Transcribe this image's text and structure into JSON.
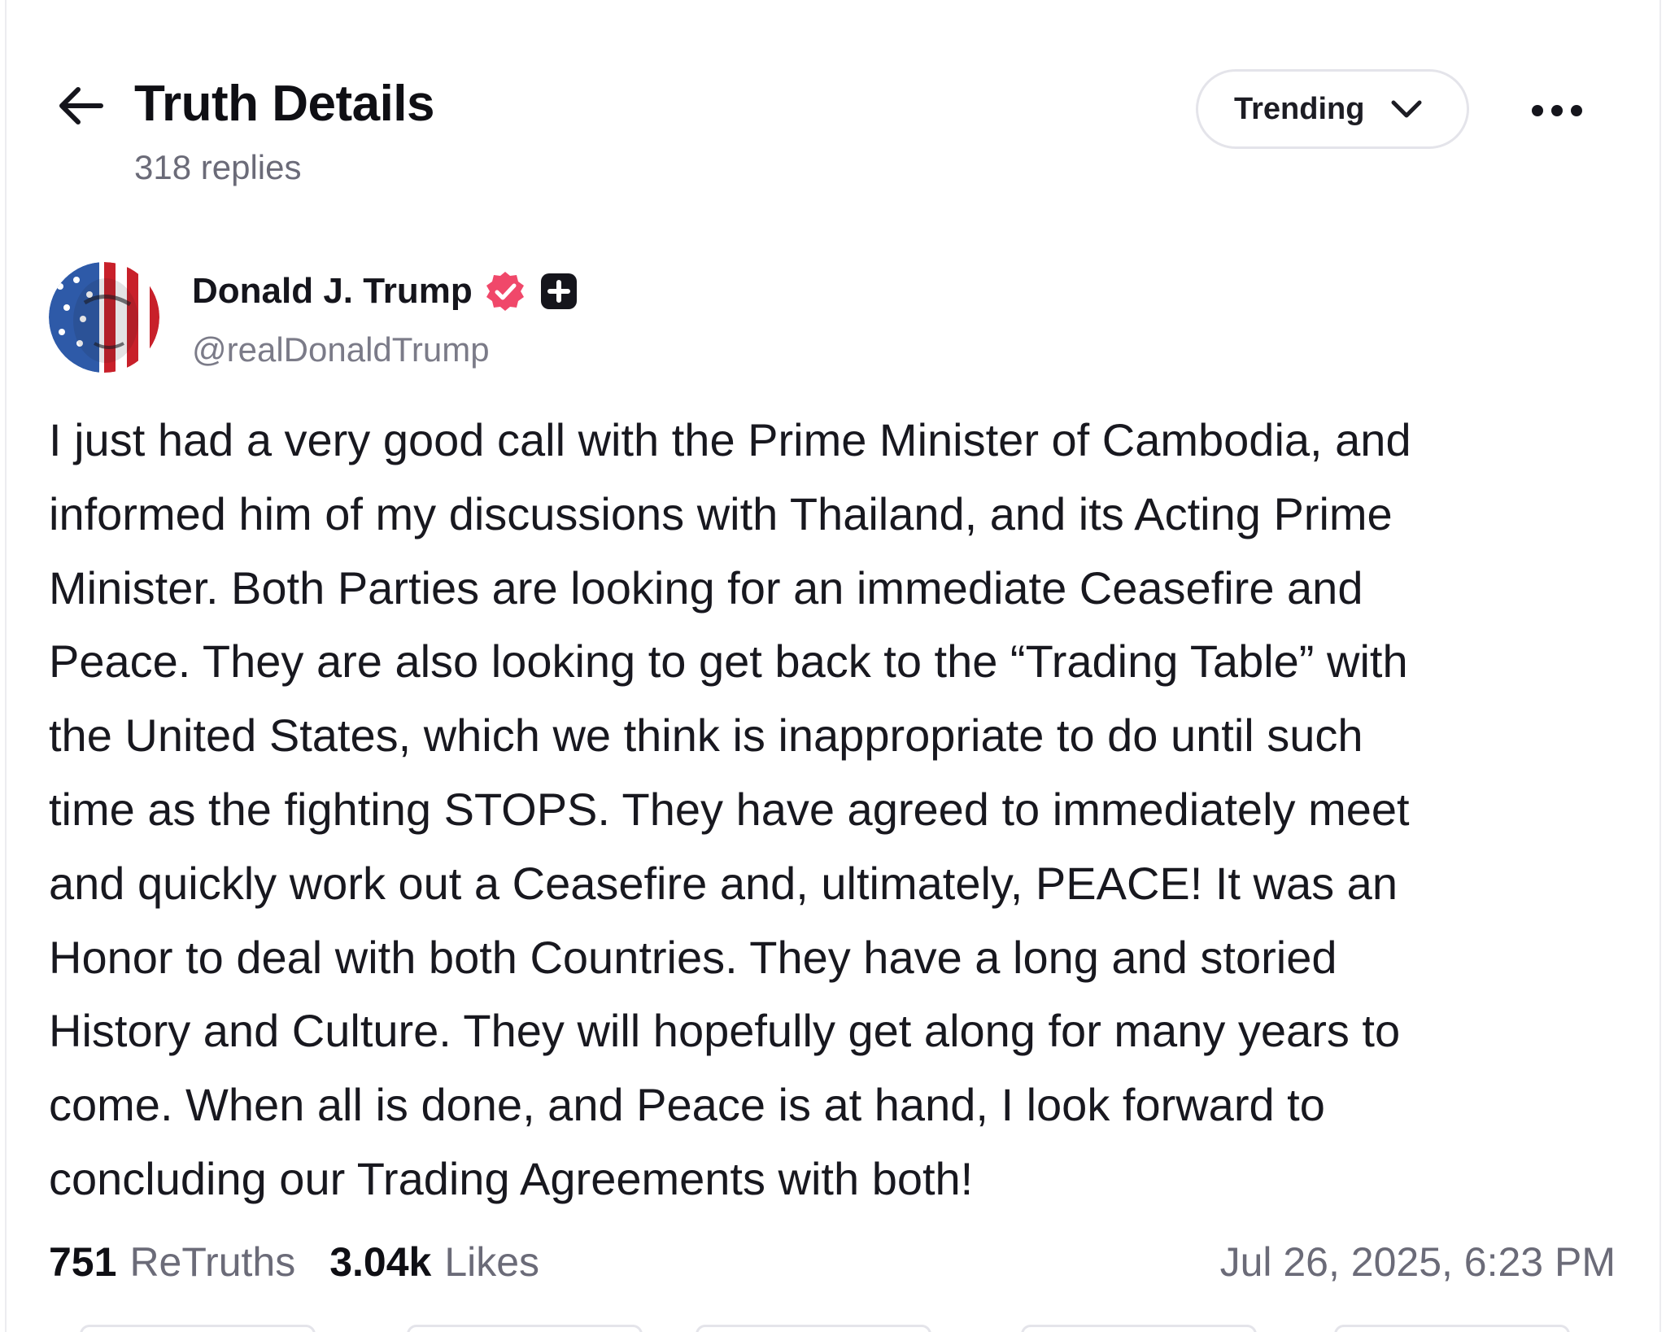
{
  "header": {
    "title": "Truth Details",
    "subtitle": "318 replies",
    "sort": {
      "selected": "Trending"
    }
  },
  "icons": {
    "back": "arrow-left-icon",
    "sort_chevron": "chevron-down-icon",
    "more": "more-horizontal-icon",
    "verified": "verified-badge-icon",
    "plus": "plus-badge-icon"
  },
  "colors": {
    "verified_badge": "#f0486a",
    "plus_badge": "#15151c",
    "muted_text": "#6b6b78"
  },
  "post": {
    "author": {
      "name": "Donald J. Trump",
      "handle": "@realDonaldTrump"
    },
    "body_lines": [
      "I just had a very good call with the Prime Minister of Cambodia, and",
      "informed him of my discussions with Thailand, and its Acting Prime",
      "Minister. Both Parties are looking for an immediate Ceasefire and",
      "Peace. They are also looking to get back to the “Trading Table” with",
      "the United States, which we think is inappropriate to do until such",
      "time as the fighting STOPS. They have agreed to immediately meet",
      "and quickly work out a Ceasefire and, ultimately, PEACE! It was an",
      "Honor to deal with both Countries. They have a long and storied",
      "History and Culture. They will hopefully get along for many years to",
      "come. When all is done, and Peace is at hand, I look forward to",
      "concluding our Trading Agreements with both!"
    ],
    "stats": {
      "retruths_count": "751",
      "retruths_label": "ReTruths",
      "likes_count": "3.04k",
      "likes_label": "Likes"
    },
    "timestamp": "Jul 26, 2025, 6:23 PM"
  }
}
